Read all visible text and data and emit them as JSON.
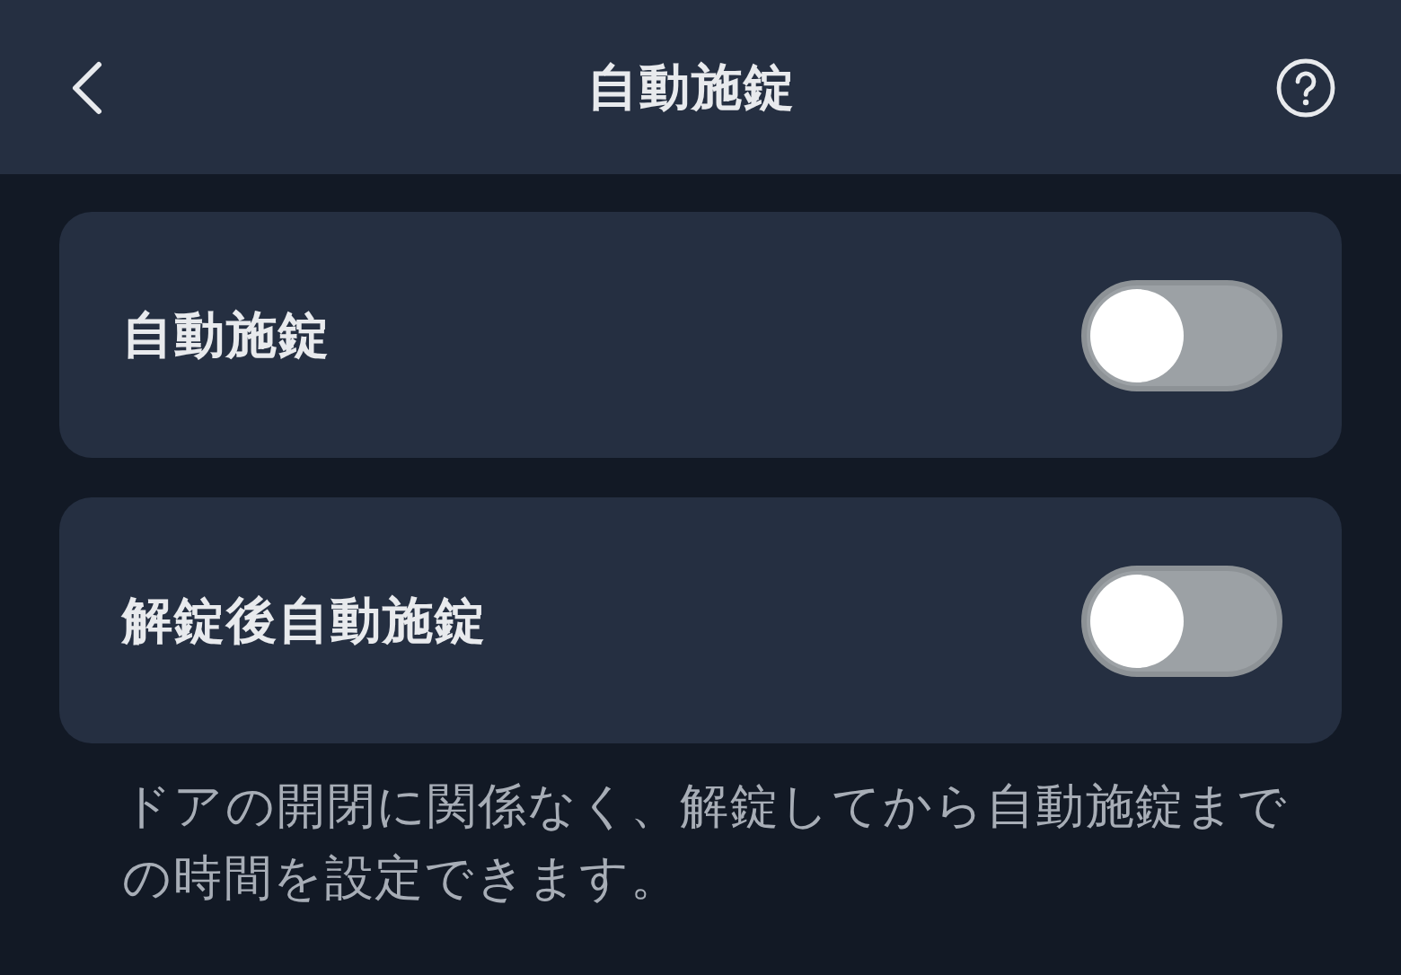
{
  "header": {
    "title": "自動施錠"
  },
  "settings": [
    {
      "label": "自動施錠",
      "on": false
    },
    {
      "label": "解錠後自動施錠",
      "on": false
    }
  ],
  "note": "ドアの開閉に関係なく、解錠してから自動施錠までの時間を設定できます。"
}
